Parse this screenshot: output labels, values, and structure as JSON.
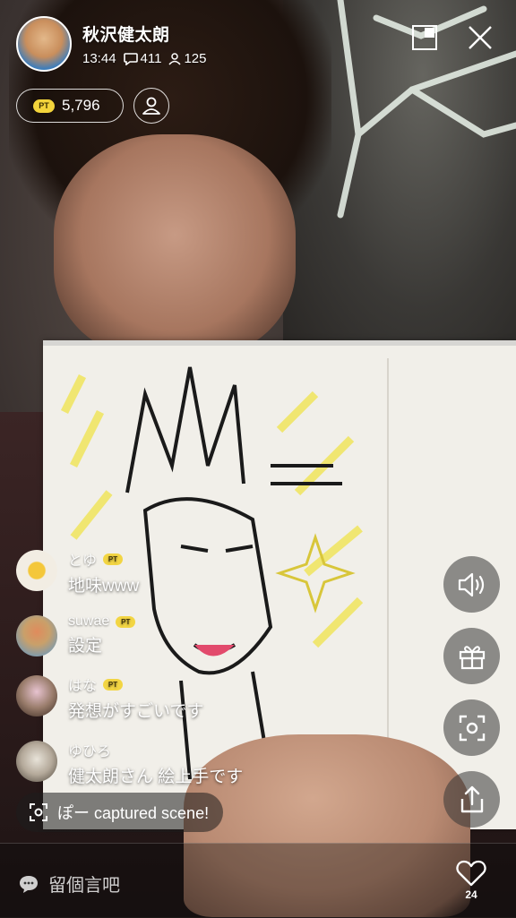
{
  "host": {
    "name": "秋沢健太朗",
    "time": "13:44",
    "comment_count": "411",
    "viewer_count": "125"
  },
  "points": {
    "badge": "PT",
    "value": "5,796"
  },
  "icons": {
    "pip": "pip-icon",
    "close": "close-icon",
    "comment": "speech-bubble-icon",
    "viewer": "person-icon",
    "follow": "person-outline-icon",
    "sound": "speaker-icon",
    "gift": "gift-icon",
    "capture": "camera-capture-icon",
    "share": "share-icon",
    "like": "heart-icon"
  },
  "comments": [
    {
      "user": "とゆ",
      "pt": "PT",
      "text": "地味www",
      "avatar_color": "#f2ede3"
    },
    {
      "user": "suwae",
      "pt": "PT",
      "text": "設定",
      "avatar_color": "#c9a06a"
    },
    {
      "user": "はな",
      "pt": "PT",
      "text": "発想がすごいです",
      "avatar_color": "#9a7d6c"
    },
    {
      "user": "ゆひろ",
      "pt": "",
      "text": "健太朗さん 絵上手です",
      "avatar_color": "#b4a99a"
    }
  ],
  "capture_notice": "ぽー captured scene!",
  "bottom": {
    "input_placeholder": "留個言吧",
    "like_count": "24"
  },
  "colors": {
    "pt_yellow": "#f3d43b",
    "accent_green": "#21c07a"
  }
}
